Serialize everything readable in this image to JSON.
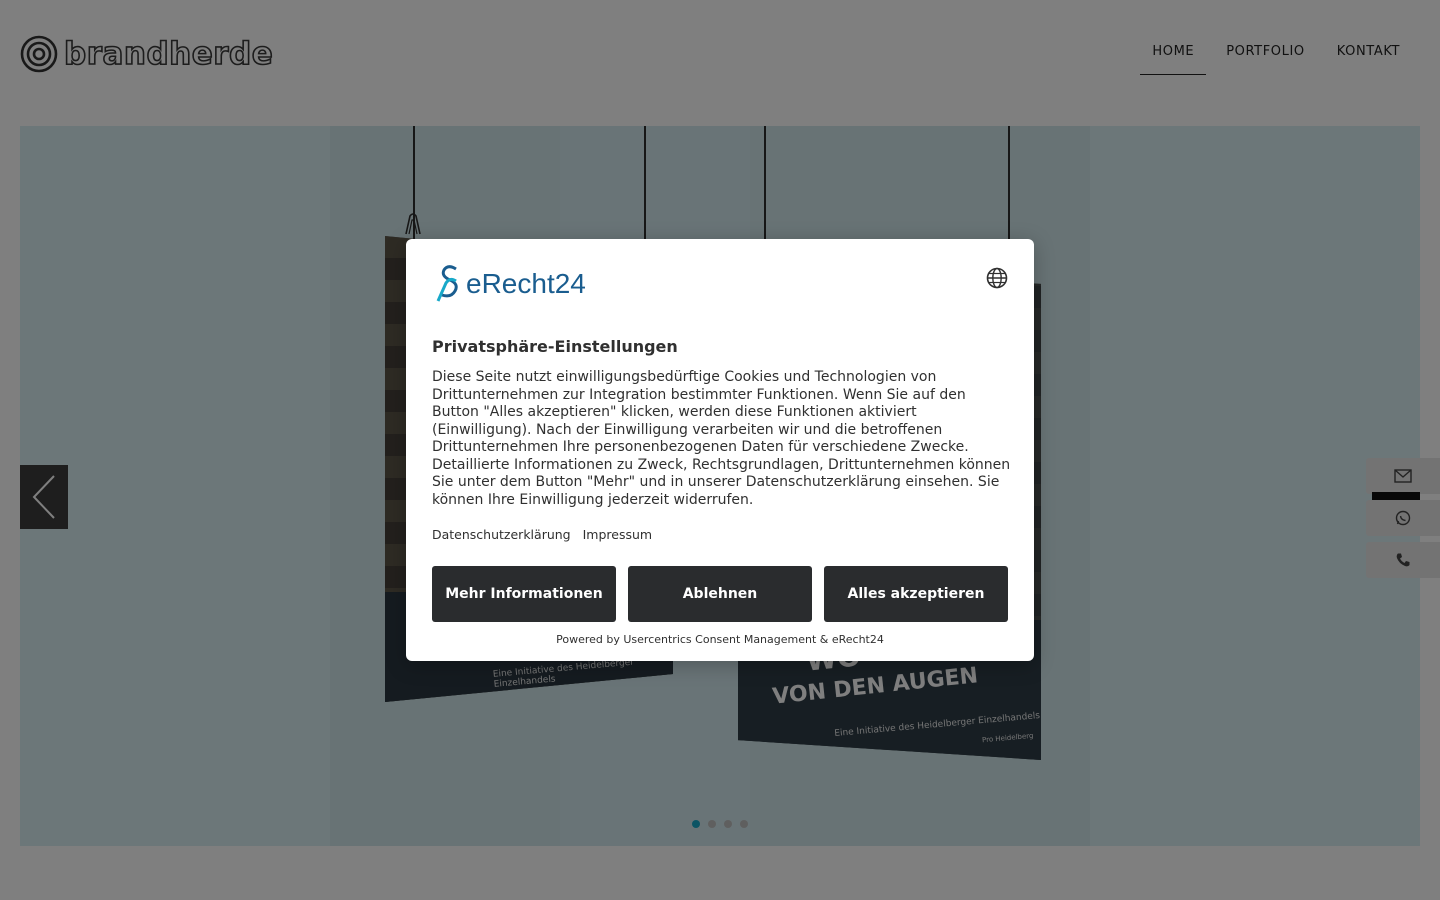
{
  "header": {
    "logo_text": "brandherde",
    "nav": [
      {
        "label": "HOME",
        "active": true
      },
      {
        "label": "PORTFOLIO",
        "active": false
      },
      {
        "label": "KONTAKT",
        "active": false
      }
    ]
  },
  "slider": {
    "posters": [
      {
        "small_text": "Eine Initiative des Heidelberger Einzelhandels"
      },
      {
        "headline_1": "WO",
        "headline_2": "VON DEN AUGEN",
        "small_text": "Eine Initiative des Heidelberger Einzelhandels",
        "brand": "Pro Heidelberg"
      }
    ],
    "dots_count": 4,
    "active_dot": 0,
    "accent_color": "#18a9c9"
  },
  "side_tabs": [
    {
      "icon": "mail-icon"
    },
    {
      "icon": "whatsapp-icon"
    },
    {
      "icon": "phone-icon"
    }
  ],
  "consent": {
    "brand": "eRecht24",
    "title": "Privatsphäre-Einstellungen",
    "body": "Diese Seite nutzt einwilligungsbedürftige Cookies und Technologien von Drittunternehmen zur Integration bestimmter Funktionen. Wenn Sie auf den Button \"Alles akzeptieren\" klicken, werden diese Funktionen aktiviert (Einwilligung). Nach der Einwilligung verarbeiten wir und die betroffenen Drittunternehmen Ihre personenbezogenen Daten für verschiedene Zwecke. Detaillierte Informationen zu Zweck, Rechtsgrundlagen, Drittunternehmen können Sie unter dem Button \"Mehr\" und in unserer Datenschutzerklärung einsehen. Sie können Ihre Einwilligung jederzeit widerrufen.",
    "links": {
      "privacy": "Datenschutzerklärung",
      "imprint": "Impressum"
    },
    "buttons": {
      "more": "Mehr Informationen",
      "decline": "Ablehnen",
      "accept": "Alles akzeptieren"
    },
    "powered_by": "Powered by Usercentrics Consent Management & eRecht24",
    "button_color": "#2a2c2e",
    "brand_color": "#1a5d8f"
  }
}
